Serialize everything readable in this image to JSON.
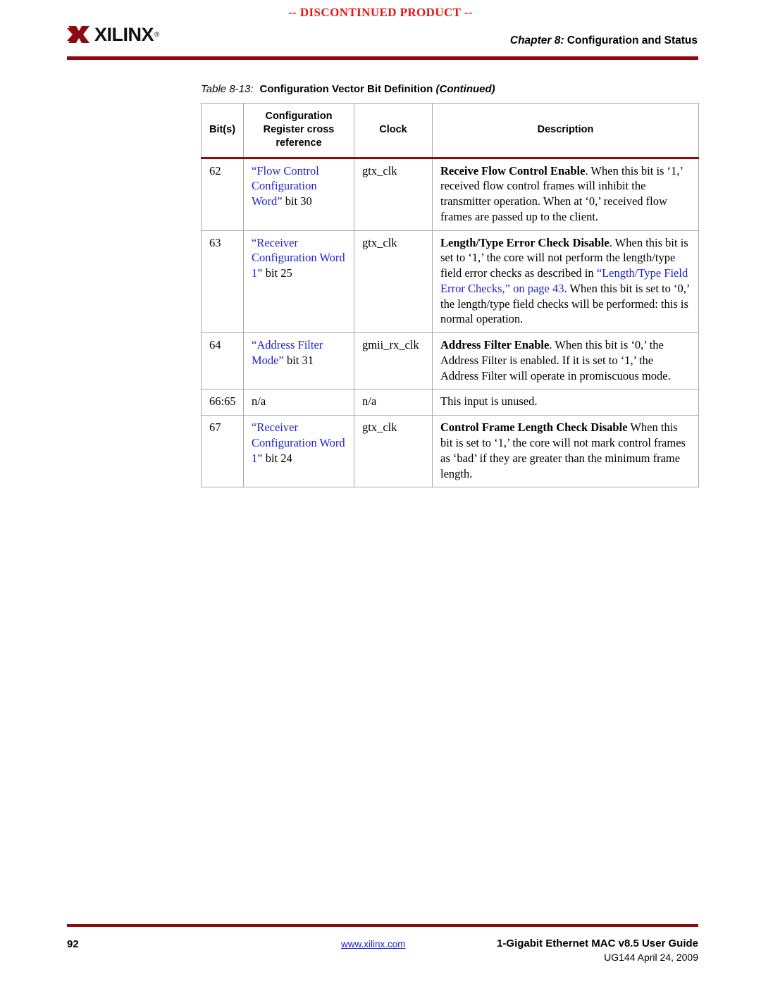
{
  "banner": {
    "text": "-- DISCONTINUED PRODUCT --",
    "color": "#ee1111"
  },
  "header": {
    "logo_text": "XILINX",
    "logo_registered": "®",
    "chapter_label": "Chapter 8:",
    "chapter_title": "Configuration and Status",
    "rule_color": "#8c0b11"
  },
  "table": {
    "caption_number": "Table 8-13:",
    "caption_title": "Configuration Vector Bit Definition",
    "caption_continued": "(Continued)",
    "columns": [
      "Bit(s)",
      "Configuration Register cross reference",
      "Clock",
      "Description"
    ],
    "column_header_lines": {
      "bits": "Bit(s)",
      "ref_line1": "Configuration",
      "ref_line2": "Register cross",
      "ref_line3": "reference",
      "clock": "Clock",
      "description": "Description"
    },
    "rows": [
      {
        "bits": "62",
        "ref_link": "“Flow Control Configuration Word”",
        "ref_tail": " bit 30",
        "clock": "gtx_clk",
        "desc_strong": "Receive Flow Control Enable",
        "desc_text": ". When this bit is ‘1,’ received flow control frames will inhibit the transmitter operation. When at ‘0,’ received flow frames are passed up to the client.",
        "desc_link": "",
        "desc_text2": ""
      },
      {
        "bits": "63",
        "ref_link": "“Receiver Configuration Word 1”",
        "ref_tail": " bit 25",
        "clock": "gtx_clk",
        "desc_strong": "Length/Type Error Check Disable",
        "desc_text": ". When this bit is set to ‘1,’ the core will not perform the length/type field error checks as described in ",
        "desc_link": "“Length/Type Field Error Checks,” on page 43",
        "desc_text2": ". When this bit is set to ‘0,’ the length/type field checks will be performed: this is normal operation."
      },
      {
        "bits": "64",
        "ref_link": "“Address Filter Mode”",
        "ref_tail": " bit 31",
        "clock": "gmii_rx_clk",
        "desc_strong": "Address Filter Enable",
        "desc_text": ". When this bit is ‘0,’ the Address Filter is enabled. If it is set to ‘1,’ the Address Filter will operate in promiscuous mode.",
        "desc_link": "",
        "desc_text2": ""
      },
      {
        "bits": "66:65",
        "ref_link": "",
        "ref_tail": "n/a",
        "clock": "n/a",
        "desc_strong": "",
        "desc_text": "This input is unused.",
        "desc_link": "",
        "desc_text2": ""
      },
      {
        "bits": "67",
        "ref_link": "“Receiver Configuration Word 1”",
        "ref_tail": " bit 24",
        "clock": "gtx_clk",
        "desc_strong": "Control Frame Length Check Disable",
        "desc_text": " When this bit is set to ‘1,’ the core will not mark control frames as ‘bad’ if they are greater than the minimum frame length.",
        "desc_link": "",
        "desc_text2": ""
      }
    ],
    "link_color": "#2222cc",
    "header_rule_color": "#8c0b11",
    "grid_color": "#a8a8a8"
  },
  "footer": {
    "page_number": "92",
    "url": "www.xilinx.com",
    "guide_title": "1-Gigabit Ethernet MAC v8.5 User Guide",
    "guide_sub": "UG144 April 24, 2009",
    "rule_color": "#8c0b11"
  }
}
